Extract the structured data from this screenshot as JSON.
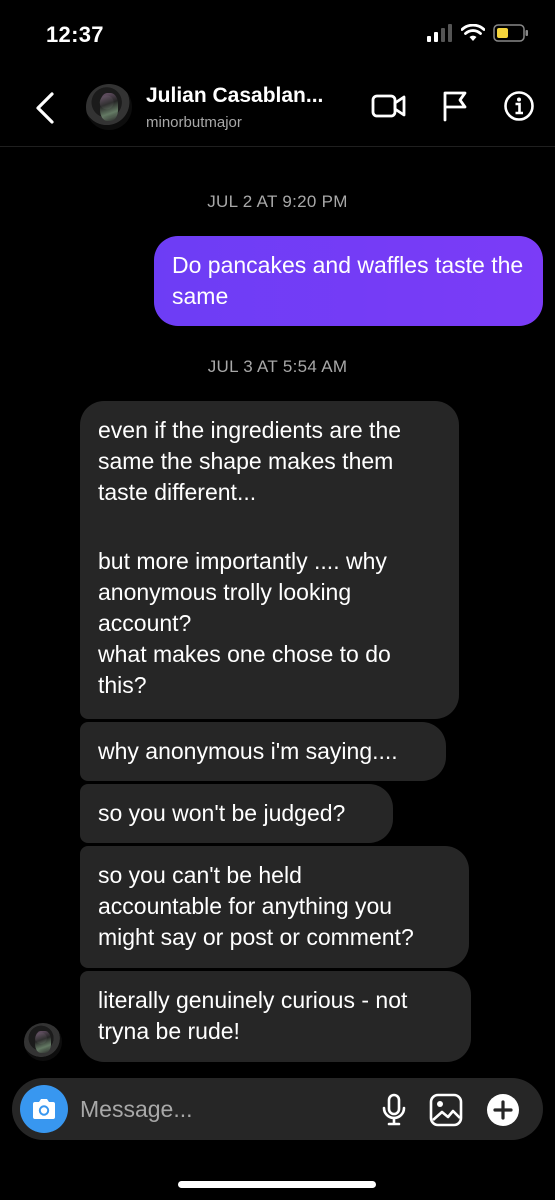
{
  "status_bar": {
    "time": "12:37"
  },
  "header": {
    "name": "Julian Casablan...",
    "username": "minorbutmajor",
    "icons": [
      "back-icon",
      "video-call-icon",
      "flag-icon",
      "info-icon"
    ]
  },
  "thread": {
    "timestamp_1": "JUL 2 AT 9:20 PM",
    "outgoing_1": "Do pancakes and waffles taste the same",
    "timestamp_2": "JUL 3 AT 5:54 AM",
    "incoming": [
      {
        "lines": [
          "even if the ingredients are the",
          "same the shape makes them",
          "taste different...",
          "",
          "but more importantly .... why",
          "anonymous trolly looking",
          "account?",
          "what makes one chose to do",
          "this?"
        ]
      },
      {
        "lines": [
          "why anonymous i'm saying...."
        ]
      },
      {
        "lines": [
          "so you won't be judged?"
        ]
      },
      {
        "lines": [
          "so you can't be held",
          "accountable for anything you",
          "might say or post or comment?"
        ]
      },
      {
        "lines": [
          "literally genuinely curious - not",
          "tryna be rude!"
        ]
      }
    ]
  },
  "composer": {
    "placeholder": "Message...",
    "icons": [
      "camera-icon",
      "microphone-icon",
      "gallery-icon",
      "add-icon"
    ]
  },
  "colors": {
    "outgoing_bubble": "#7340f6",
    "incoming_bubble": "#262626",
    "camera_button": "#3897f0",
    "battery": "#f5d53c"
  }
}
